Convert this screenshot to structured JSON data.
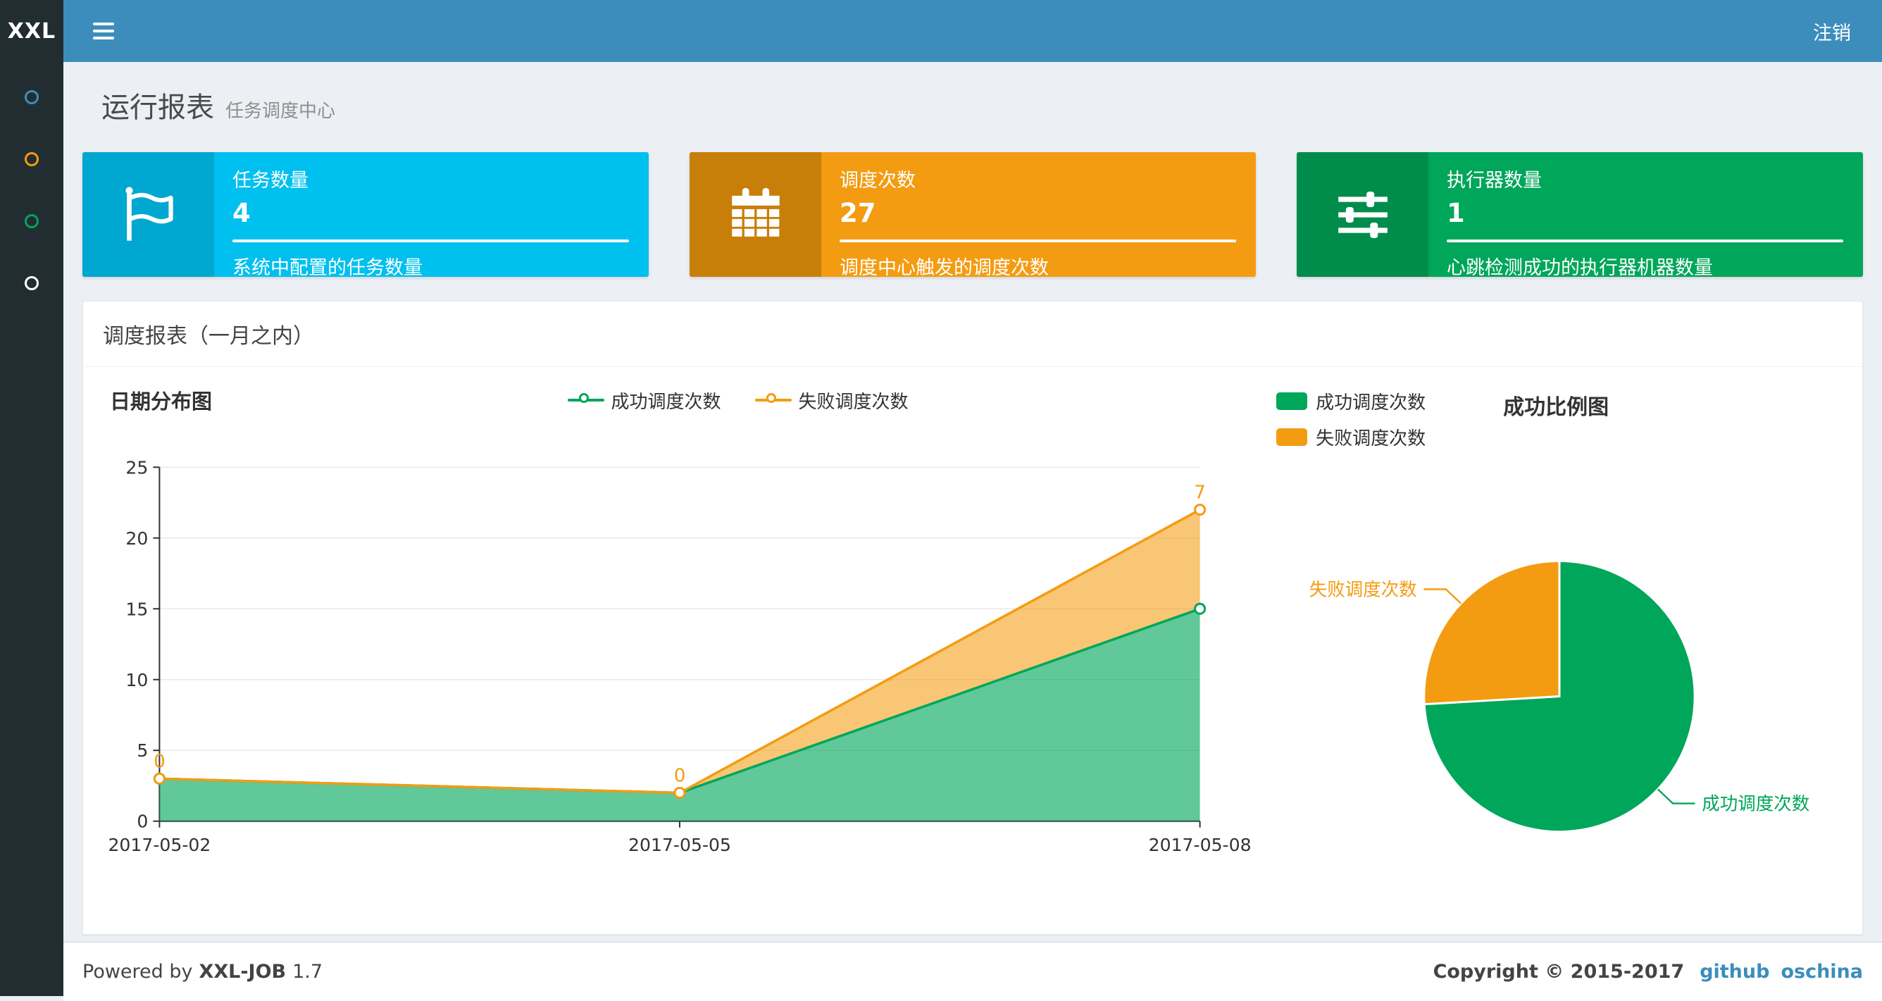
{
  "navbar": {
    "logo_text": "XXL",
    "logout_label": "注销",
    "bg": "#3c8dbc",
    "logo_bg": "#222d32"
  },
  "sidebar": {
    "bg": "#222d32",
    "items": [
      {
        "icon": "circle-icon",
        "color": "#3c8dbc"
      },
      {
        "icon": "circle-icon",
        "color": "#f39c12"
      },
      {
        "icon": "circle-icon",
        "color": "#00a65a"
      },
      {
        "icon": "circle-icon",
        "color": "#ffffff"
      }
    ]
  },
  "page": {
    "title": "运行报表",
    "subtitle": "任务调度中心"
  },
  "info_boxes": [
    {
      "icon": "flag-icon",
      "title": "任务数量",
      "number": "4",
      "description": "系统中配置的任务数量",
      "bg": "#00c0ef",
      "icon_bg": "#00a7d0"
    },
    {
      "icon": "calendar-icon",
      "title": "调度次数",
      "number": "27",
      "description": "调度中心触发的调度次数",
      "bg": "#f39c12",
      "icon_bg": "#c87f0a"
    },
    {
      "icon": "sliders-icon",
      "title": "执行器数量",
      "number": "1",
      "description": "心跳检测成功的执行器机器数量",
      "bg": "#00a65a",
      "icon_bg": "#008d4c"
    }
  ],
  "panel": {
    "title": "调度报表（一月之内）"
  },
  "chart_data": [
    {
      "type": "area",
      "title": "日期分布图",
      "x": [
        "2017-05-02",
        "2017-05-05",
        "2017-05-08"
      ],
      "stacked": true,
      "series": [
        {
          "name": "成功调度次数",
          "values": [
            3,
            2,
            15
          ],
          "color": "#00a65a"
        },
        {
          "name": "失败调度次数",
          "values": [
            0,
            0,
            7
          ],
          "color": "#f39c12",
          "labels": [
            "0",
            "0",
            "7"
          ]
        }
      ],
      "ylim": [
        0,
        25
      ],
      "yticks": [
        0,
        5,
        10,
        15,
        20,
        25
      ],
      "grid": true,
      "legend_position": "top-center"
    },
    {
      "type": "pie",
      "title": "成功比例图",
      "slices": [
        {
          "name": "成功调度次数",
          "value": 20,
          "color": "#00a65a"
        },
        {
          "name": "失败调度次数",
          "value": 7,
          "color": "#f39c12"
        }
      ],
      "legend_position": "top-left"
    }
  ],
  "footer": {
    "powered_by": "Powered by",
    "product": "XXL-JOB",
    "version": "1.7",
    "copyright": "Copyright © 2015-2017",
    "links": [
      "github",
      "oschina"
    ]
  }
}
